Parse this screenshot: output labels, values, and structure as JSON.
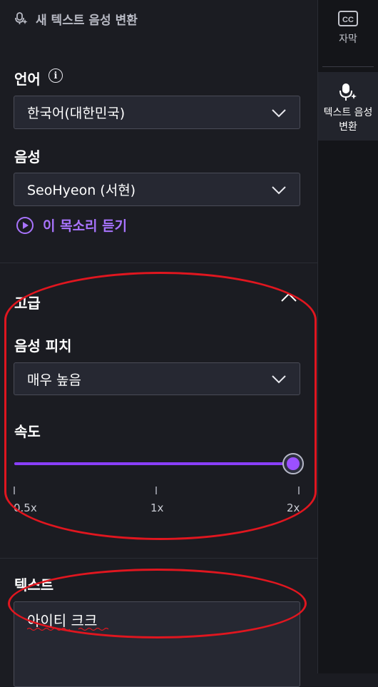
{
  "panel": {
    "title": "새 텍스트 음성 변환",
    "language": {
      "label": "언어",
      "value": "한국어(대한민국)"
    },
    "voice": {
      "label": "음성",
      "value": "SeoHyeon (서현)",
      "listen_label": "이 목소리 듣기"
    },
    "advanced": {
      "label": "고급",
      "pitch": {
        "label": "음성 피치",
        "value": "매우 높음"
      },
      "speed": {
        "label": "속도",
        "level_fraction": 1.0,
        "ticks": [
          "0.5x",
          "1x",
          "2x"
        ]
      }
    },
    "text": {
      "label": "텍스트",
      "value": "아이티 크크"
    }
  },
  "rail": {
    "items": [
      {
        "icon": "closed-captions-icon",
        "label": "자막"
      },
      {
        "icon": "voice-sparkle-icon",
        "label_line1": "텍스트 음성",
        "label_line2": "변환"
      }
    ]
  },
  "colors": {
    "accent": "#9b50ff",
    "annotation": "#e0161f",
    "background": "#1b1c22"
  }
}
